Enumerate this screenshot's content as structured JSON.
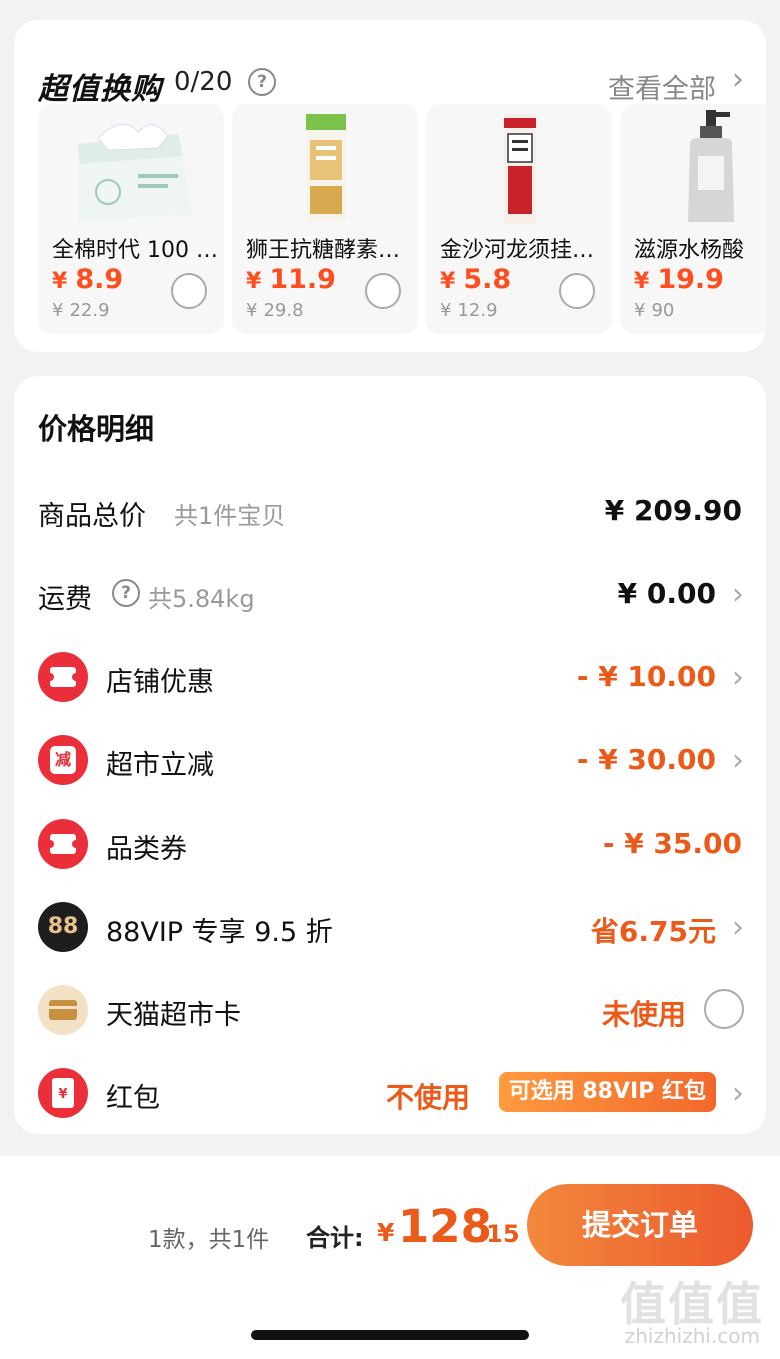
{
  "exchange": {
    "title": "超值换购",
    "count": "0/20",
    "help_symbol": "?",
    "view_all": "查看全部",
    "chevron": "›",
    "products": [
      {
        "name": "全棉时代 100 …",
        "currency": "¥",
        "price": "8.9",
        "original": "22.9",
        "image": "tissue-box-image"
      },
      {
        "name": "狮王抗糖酵素…",
        "currency": "¥",
        "price": "11.9",
        "original": "29.8",
        "image": "toothpaste-image"
      },
      {
        "name": "金沙河龙须挂…",
        "currency": "¥",
        "price": "5.8",
        "original": "12.9",
        "image": "noodle-pack-image"
      },
      {
        "name": "滋源水杨酸",
        "currency": "¥",
        "price": "19.9",
        "original": "90",
        "image": "shampoo-bottle-image"
      }
    ]
  },
  "detail": {
    "title": "价格明细",
    "chevron": "›",
    "goods": {
      "label": "商品总价",
      "sub": "共1件宝贝",
      "value": "¥ 209.90"
    },
    "shipping": {
      "label": "运费",
      "help_symbol": "?",
      "sub": "共5.84kg",
      "value": "¥ 0.00"
    },
    "shop_discount": {
      "label": "店铺优惠",
      "value": "- ¥ 10.00",
      "icon": "ticket-icon"
    },
    "market_cut": {
      "label": "超市立减",
      "value": "- ¥ 30.00",
      "icon_text": "减"
    },
    "category_coupon": {
      "label": "品类券",
      "value": "- ¥ 35.00",
      "icon": "ticket-icon"
    },
    "vip": {
      "label": "88VIP 专享 9.5 折",
      "value": "省6.75元",
      "icon_text": "88"
    },
    "market_card": {
      "label": "天猫超市卡",
      "value": "未使用",
      "icon": "card-icon"
    },
    "red_packet": {
      "label": "红包",
      "value": "不使用",
      "tag": "可选用 88VIP 红包",
      "icon_text": "¥"
    }
  },
  "bottom": {
    "count": "1款，共1件",
    "total_label": "合计:",
    "currency": "¥",
    "total_int": "128",
    "total_dec": ".15",
    "submit": "提交订单"
  },
  "watermark": {
    "glyphs": "值值值",
    "url": "zhizhizhi.com"
  },
  "colors": {
    "accent": "#ec5a1a",
    "price_red": "#ff4d1d",
    "icon_red": "#ea2e3a",
    "button_start": "#f2883c",
    "button_end": "#ec5a2e"
  }
}
